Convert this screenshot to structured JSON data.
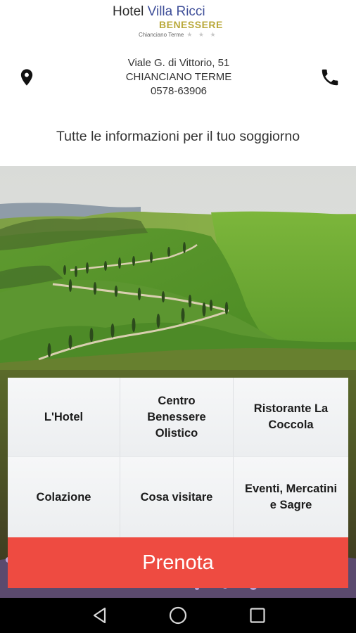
{
  "logo": {
    "hotel_word": "Hotel",
    "brand": "Villa Ricci",
    "subtitle": "BENESSERE",
    "town": "Chianciano Terme",
    "stars": "★ ★ ★"
  },
  "contact": {
    "address_line1": "Viale G. di Vittorio, 51",
    "address_line2": "CHIANCIANO TERME",
    "phone": "0578-63906",
    "location_icon": "location-pin-icon",
    "phone_icon": "phone-icon"
  },
  "tagline": "Tutte le informazioni per il tuo soggiorno",
  "menu": {
    "items": [
      {
        "label": "L'Hotel"
      },
      {
        "label": "Centro Benessere Olistico"
      },
      {
        "label": "Ristorante La Coccola"
      },
      {
        "label": "Colazione"
      },
      {
        "label": "Cosa visitare"
      },
      {
        "label": "Eventi, Mercatini e Sagre"
      }
    ]
  },
  "book_button": "Prenota",
  "navbar": {
    "back_icon": "back-triangle-icon",
    "home_icon": "home-circle-icon",
    "recents_icon": "recents-square-icon"
  },
  "colors": {
    "brand_blue": "#3f4f99",
    "brand_gold": "#b9a83a",
    "book_red": "#ee4b41"
  }
}
